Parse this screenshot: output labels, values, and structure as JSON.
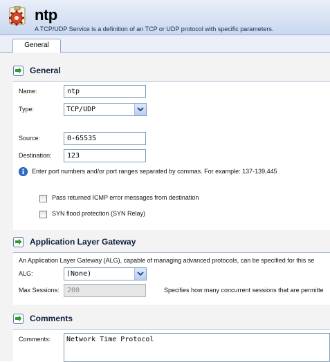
{
  "header": {
    "title": "ntp",
    "subtitle": "A TCP/UDP Service is a definition of an TCP or UDP protocol with specific parameters.",
    "icon": "service-gear-icon"
  },
  "tabs": [
    {
      "label": "General",
      "active": true
    }
  ],
  "general": {
    "heading": "General",
    "name_label": "Name:",
    "name_value": "ntp",
    "type_label": "Type:",
    "type_value": "TCP/UDP",
    "source_label": "Source:",
    "source_value": "0-65535",
    "destination_label": "Destination:",
    "destination_value": "123",
    "info_text": "Enter port numbers and/or port ranges separated by commas. For example: 137-139,445",
    "pass_icmp_label": "Pass returned ICMP error messages from destination",
    "pass_icmp_checked": false,
    "syn_label": "SYN flood protection (SYN Relay)",
    "syn_checked": false
  },
  "alg": {
    "heading": "Application Layer Gateway",
    "description": "An Application Layer Gateway (ALG), capable of managing advanced protocols, can be specified for this se",
    "alg_label": "ALG:",
    "alg_value": "(None)",
    "max_sessions_label": "Max Sessions:",
    "max_sessions_value": "200",
    "max_sessions_note": "Specifies how many concurrent sessions that are permitte"
  },
  "comments": {
    "heading": "Comments",
    "label": "Comments:",
    "value": "Network Time Protocol"
  },
  "colors": {
    "header_bg": "#d6e1f3",
    "panel_bg": "#f3f3f3",
    "input_border": "#7f9db9",
    "heading_text": "#11203f"
  }
}
